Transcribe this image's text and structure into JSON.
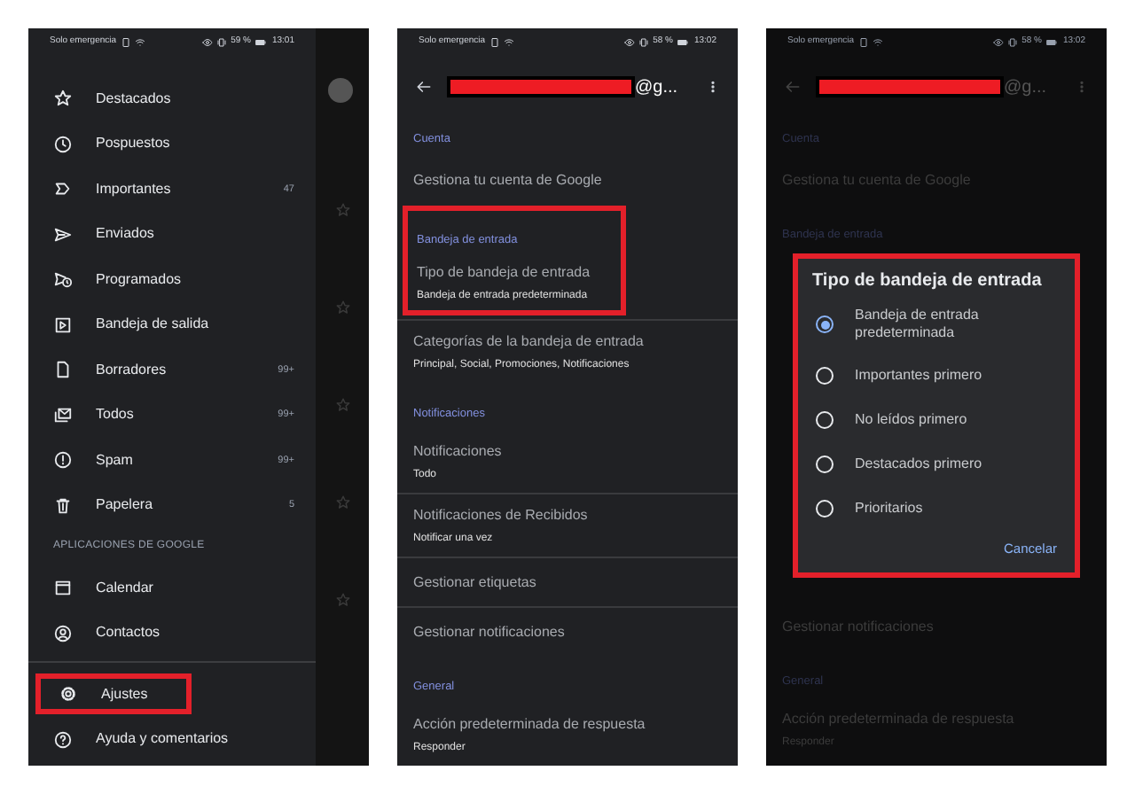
{
  "drawer_screen": {
    "status_bar": {
      "carrier": "Solo emergencia",
      "battery": "59 %",
      "time": "13:01"
    },
    "items": [
      {
        "kind": "item",
        "label": "Destacados",
        "highlighted": false
      },
      {
        "kind": "item",
        "label": "Pospuestos",
        "highlighted": false
      },
      {
        "kind": "item",
        "label": "Importantes",
        "count": "47",
        "highlighted": false
      },
      {
        "kind": "item",
        "label": "Enviados",
        "highlighted": false
      },
      {
        "kind": "item",
        "label": "Programados",
        "highlighted": false
      },
      {
        "kind": "item",
        "label": "Bandeja de salida",
        "highlighted": false
      },
      {
        "kind": "item",
        "label": "Borradores",
        "count": "99+",
        "highlighted": false
      },
      {
        "kind": "item",
        "label": "Todos",
        "count": "99+",
        "highlighted": false
      },
      {
        "kind": "item",
        "label": "Spam",
        "count": "99+",
        "highlighted": false
      },
      {
        "kind": "item",
        "label": "Papelera",
        "count": "5",
        "highlighted": false
      },
      {
        "kind": "heading",
        "label": "APLICACIONES DE GOOGLE"
      },
      {
        "kind": "item",
        "label": "Calendar",
        "highlighted": false
      },
      {
        "kind": "item",
        "label": "Contactos",
        "highlighted": false
      },
      {
        "kind": "divider"
      },
      {
        "kind": "item",
        "label": "Ajustes",
        "highlighted": true
      },
      {
        "kind": "item",
        "label": "Ayuda y comentarios",
        "highlighted": false
      }
    ]
  },
  "settings_screen": {
    "status_bar": {
      "carrier": "Solo emergencia",
      "battery": "58 %",
      "time": "13:02"
    },
    "account": "@g...",
    "sections": [
      {
        "title": "Cuenta",
        "highlighted": false,
        "items": [
          {
            "title": "Gestiona tu cuenta de Google"
          }
        ]
      },
      {
        "title": "Bandeja de entrada",
        "highlighted": true,
        "items": [
          {
            "title": "Tipo de bandeja de entrada",
            "subtitle": "Bandeja de entrada predeterminada"
          },
          {
            "title": "Categorías de la bandeja de entrada",
            "subtitle": "Principal, Social, Promociones, Notificaciones"
          }
        ]
      },
      {
        "title": "Notificaciones",
        "highlighted": false,
        "items": [
          {
            "title": "Notificaciones",
            "subtitle": "Todo"
          },
          {
            "title": "Notificaciones de Recibidos",
            "subtitle": "Notificar una vez"
          },
          {
            "title": "Gestionar etiquetas"
          },
          {
            "title": "Gestionar notificaciones"
          }
        ]
      },
      {
        "title": "General",
        "highlighted": false,
        "items": [
          {
            "title": "Acción predeterminada de respuesta",
            "subtitle": "Responder"
          }
        ]
      }
    ]
  },
  "dialog_screen": {
    "status_bar": {
      "carrier": "Solo emergencia",
      "battery": "58 %",
      "time": "13:02"
    },
    "account": "@g...",
    "rows_above": [
      {
        "kind": "section",
        "title": "Cuenta"
      },
      {
        "kind": "item",
        "title": "Gestiona tu cuenta de Google"
      },
      {
        "kind": "section",
        "title": "Bandeja de entrada"
      }
    ],
    "dialog": {
      "title": "Tipo de bandeja de entrada",
      "options": [
        {
          "label": "Bandeja de entrada predeterminada",
          "selected": true
        },
        {
          "label": "Importantes primero",
          "selected": false
        },
        {
          "label": "No leídos primero",
          "selected": false
        },
        {
          "label": "Destacados primero",
          "selected": false
        },
        {
          "label": "Prioritarios",
          "selected": false
        }
      ],
      "button": "Cancelar"
    },
    "rows_below": [
      {
        "kind": "item",
        "title": "Gestionar notificaciones"
      },
      {
        "kind": "section",
        "title": "General"
      },
      {
        "kind": "item",
        "title": "Acción predeterminada de respuesta",
        "subtitle": "Responder"
      }
    ]
  }
}
